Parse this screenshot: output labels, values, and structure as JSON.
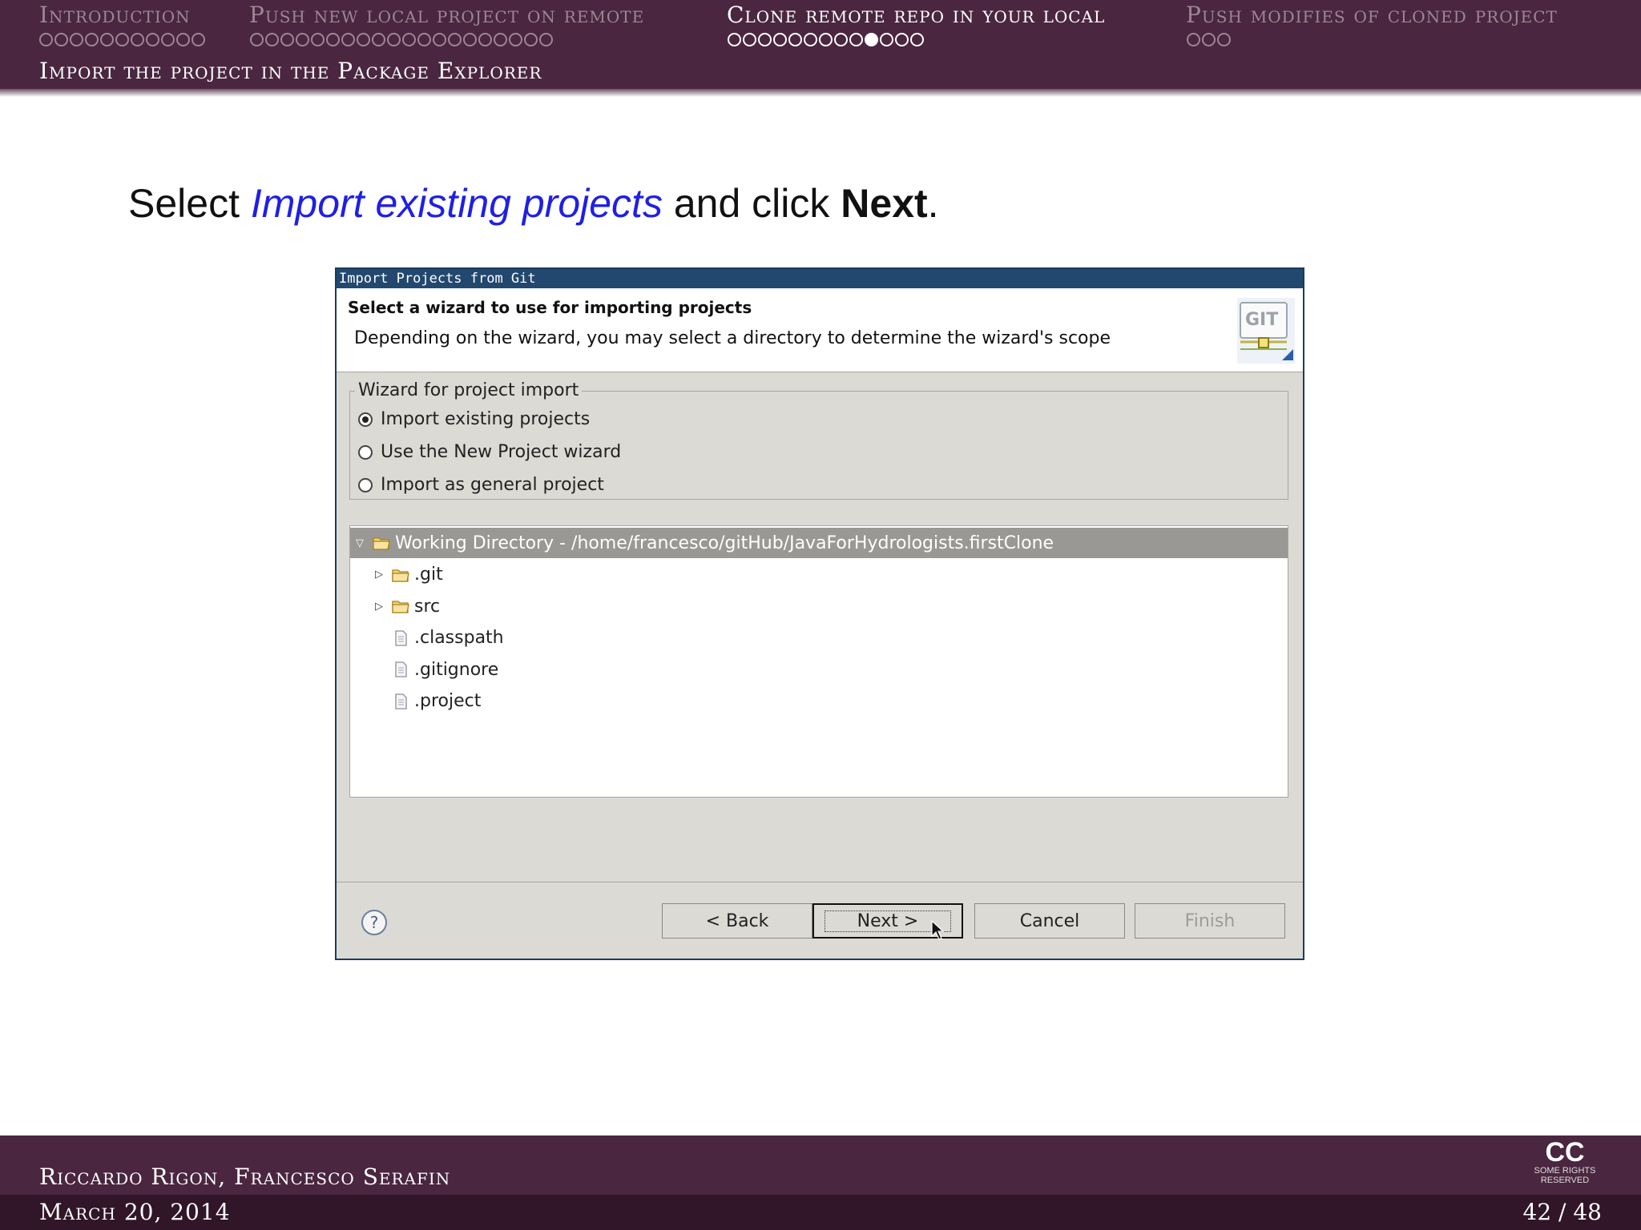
{
  "nav": {
    "sections": [
      {
        "label": "Introduction",
        "dots": 11,
        "filled": [],
        "active": false
      },
      {
        "label": "Push new local project on remote",
        "dots": 20,
        "filled": [],
        "active": false
      },
      {
        "label": "Clone remote repo in your local",
        "dots": 13,
        "filled": [
          9
        ],
        "active": true
      },
      {
        "label": "Push modifies of cloned project",
        "dots": 3,
        "filled": [],
        "active": false
      }
    ],
    "subsection": "Import the project in the Package Explorer"
  },
  "headline": {
    "pre": "Select ",
    "highlight": "Import existing projects",
    "mid": " and click ",
    "bold": "Next",
    "post": "."
  },
  "dialog": {
    "title": "Import Projects from Git",
    "header_title": "Select a wizard to use for importing projects",
    "header_desc": "Depending on the wizard, you may select a directory to determine the wizard's scope",
    "group_label": "Wizard for project import",
    "options": [
      {
        "label": "Import existing projects",
        "selected": true
      },
      {
        "label": "Use the New Project wizard",
        "selected": false
      },
      {
        "label": "Import as general project",
        "selected": false
      }
    ],
    "tree": [
      {
        "label": "Working Directory - /home/francesco/gitHub/JavaForHydrologists.firstClone",
        "type": "folder",
        "expanded": true,
        "level": 0,
        "selected": true
      },
      {
        "label": ".git",
        "type": "folder",
        "expanded": false,
        "level": 1,
        "selected": false
      },
      {
        "label": "src",
        "type": "folder",
        "expanded": false,
        "level": 1,
        "selected": false
      },
      {
        "label": ".classpath",
        "type": "file",
        "level": 1,
        "selected": false
      },
      {
        "label": ".gitignore",
        "type": "file",
        "level": 1,
        "selected": false
      },
      {
        "label": ".project",
        "type": "file",
        "level": 1,
        "selected": false
      }
    ],
    "buttons": {
      "back": "< Back",
      "next": "Next >",
      "cancel": "Cancel",
      "finish": "Finish"
    },
    "logo_text": "GIT"
  },
  "footer": {
    "authors": "Riccardo Rigon, Francesco Serafin",
    "date": "March 20, 2014",
    "page": "42 / 48",
    "cc_big": "CC",
    "cc_small": "SOME RIGHTS RESERVED"
  },
  "colors": {
    "beamer_bar": "#4a2640",
    "dialog_title": "#23486f",
    "highlight": "#1f1fe6",
    "selection": "#9a9894"
  }
}
